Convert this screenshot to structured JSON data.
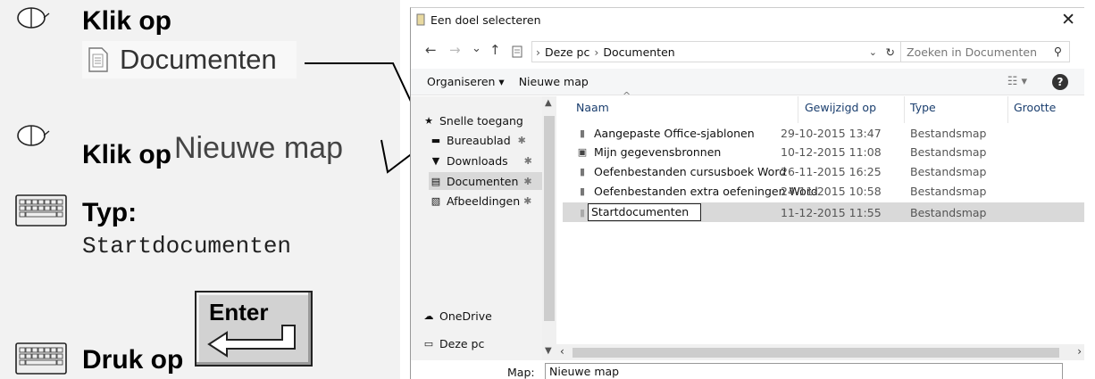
{
  "instructions": {
    "step1": {
      "action": "Klik op",
      "target": "Documenten"
    },
    "step2": {
      "action": "Klik op",
      "target": "Nieuwe map"
    },
    "step3": {
      "action": "Typ:",
      "value": "Startdocumenten"
    },
    "step4": {
      "action": "Druk op",
      "key": "Enter"
    }
  },
  "dialog": {
    "title": "Een doel selecteren",
    "close_glyph": "✕",
    "nav_buttons": {
      "back": "←",
      "forward": "→",
      "recent": "⌄",
      "up": "↑"
    },
    "breadcrumb": [
      "Deze pc",
      "Documenten"
    ],
    "search_placeholder": "Zoeken in Documenten",
    "toolbar": {
      "organize": "Organiseren ▾",
      "new_folder": "Nieuwe map",
      "view": "☷ ▾",
      "help": "?"
    },
    "nav_items": [
      {
        "label": "Snelle toegang",
        "icon": "star-icon",
        "pinned": false
      },
      {
        "label": "Bureaublad",
        "icon": "desktop-icon",
        "pinned": true
      },
      {
        "label": "Downloads",
        "icon": "download-icon",
        "pinned": true
      },
      {
        "label": "Documenten",
        "icon": "document-icon",
        "pinned": true,
        "selected": true
      },
      {
        "label": "Afbeeldingen",
        "icon": "image-icon",
        "pinned": true
      },
      {
        "label": "OneDrive",
        "icon": "cloud-icon",
        "pinned": false
      },
      {
        "label": "Deze pc",
        "icon": "computer-icon",
        "pinned": false
      }
    ],
    "columns": [
      "Naam",
      "Gewijzigd op",
      "Type",
      "Grootte"
    ],
    "files": [
      {
        "name": "Aangepaste Office-sjablonen",
        "modified": "29-10-2015 13:47",
        "type": "Bestandsmap"
      },
      {
        "name": "Mijn gegevensbronnen",
        "modified": "10-12-2015 11:08",
        "type": "Bestandsmap"
      },
      {
        "name": "Oefenbestanden cursusboek Word",
        "modified": "26-11-2015 16:25",
        "type": "Bestandsmap"
      },
      {
        "name": "Oefenbestanden extra oefeningen Word",
        "modified": "24-11-2015 10:58",
        "type": "Bestandsmap"
      },
      {
        "name": "Startdocumenten",
        "modified": "11-12-2015 11:55",
        "type": "Bestandsmap",
        "editing": true
      }
    ],
    "folder_field": {
      "label": "Map:",
      "value": "Nieuwe map"
    }
  }
}
